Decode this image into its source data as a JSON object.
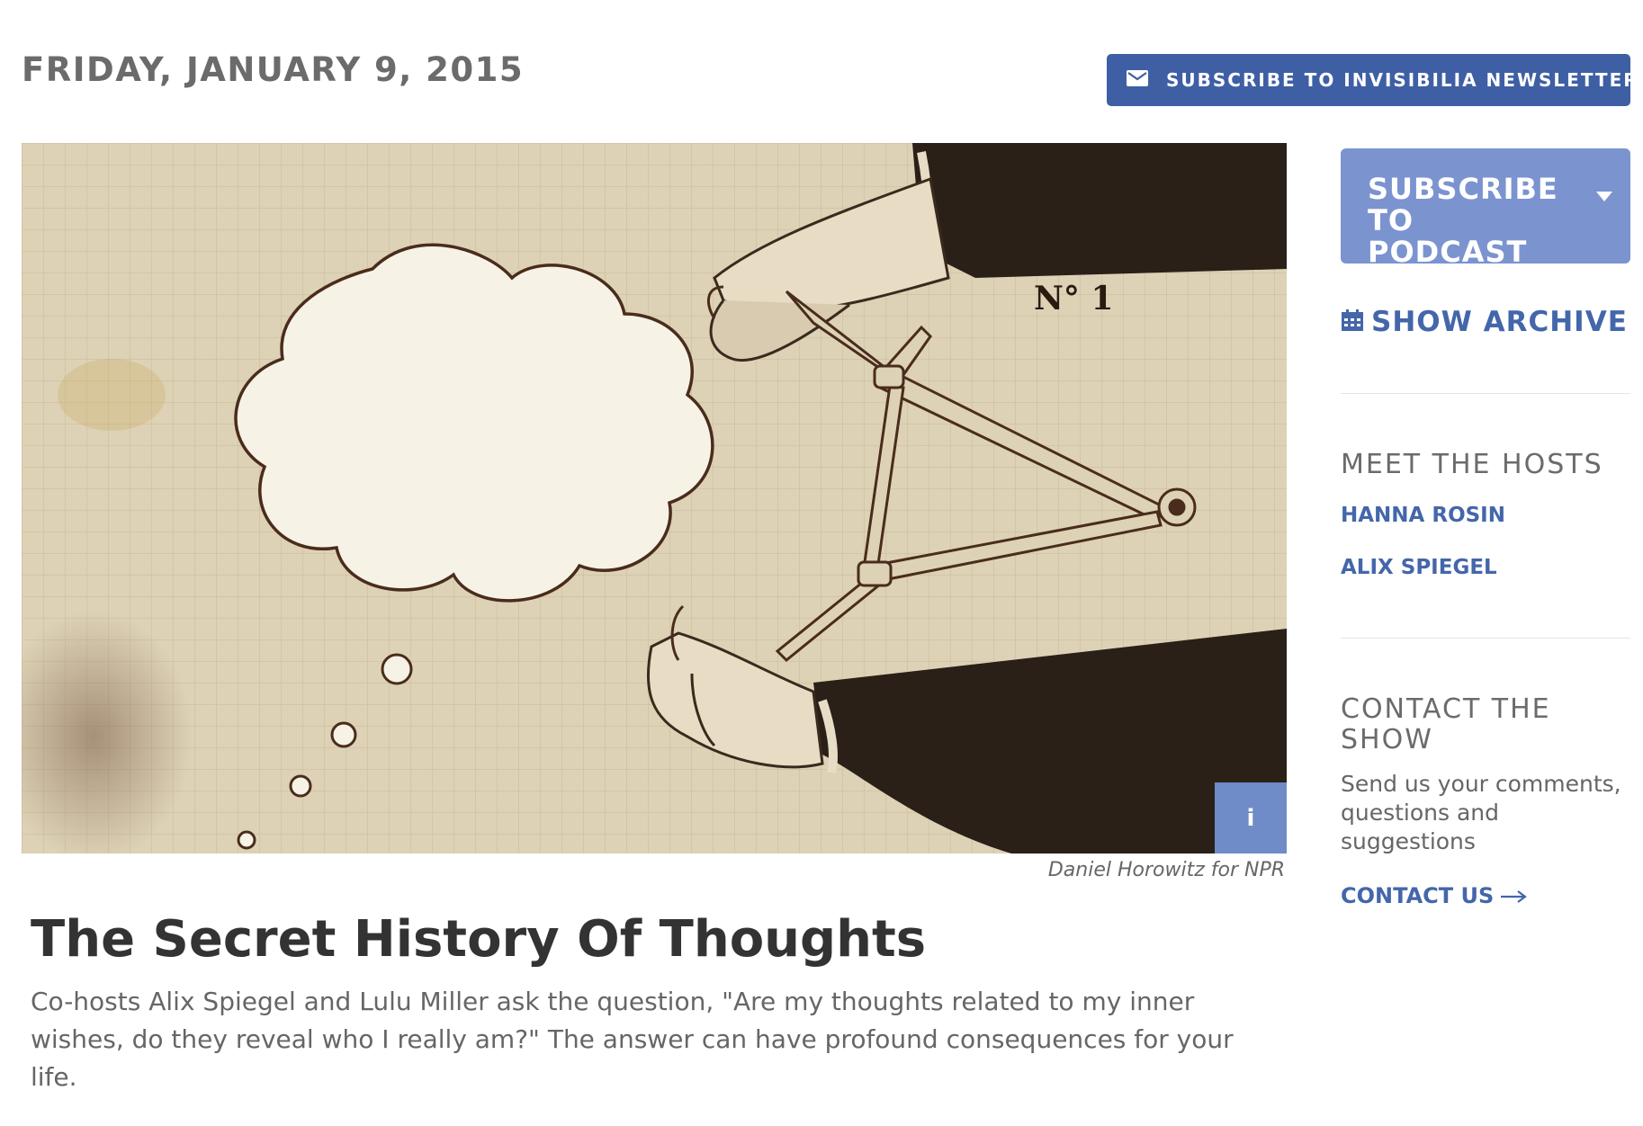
{
  "header": {
    "date": "FRIDAY, JANUARY 9, 2015",
    "newsletter_button": {
      "label": "SUBSCRIBE TO INVISIBILIA NEWSLETTER",
      "icon": "envelope-icon"
    }
  },
  "article": {
    "image": {
      "alt": "Illustration of hands holding a caliper and a thought bubble",
      "plate_label": "N° 1",
      "info_button": "i",
      "credit": "Daniel Horowitz for NPR"
    },
    "title": "The Secret History Of Thoughts",
    "teaser": "Co-hosts Alix Spiegel and Lulu Miller ask the question, \"Are my thoughts related to my inner wishes, do they reveal who I really am?\" The answer can have profound consequences for your life."
  },
  "sidebar": {
    "podcast_button": {
      "label": "SUBSCRIBE TO PODCAST",
      "icon": "caret-down-icon"
    },
    "archive_link": {
      "label": "SHOW ARCHIVE",
      "icon": "calendar-icon"
    },
    "hosts": {
      "heading": "MEET THE HOSTS",
      "items": [
        "HANNA ROSIN",
        "ALIX SPIEGEL"
      ]
    },
    "contact": {
      "heading": "CONTACT THE SHOW",
      "text": "Send us your comments, questions and suggestions",
      "link_label": "CONTACT US",
      "link_icon": "arrow-right-icon"
    }
  },
  "colors": {
    "primary_blue": "#3f5fa5",
    "light_blue": "#7b94d0",
    "link_blue": "#4466aa",
    "text_gray": "#6b6b6b"
  }
}
